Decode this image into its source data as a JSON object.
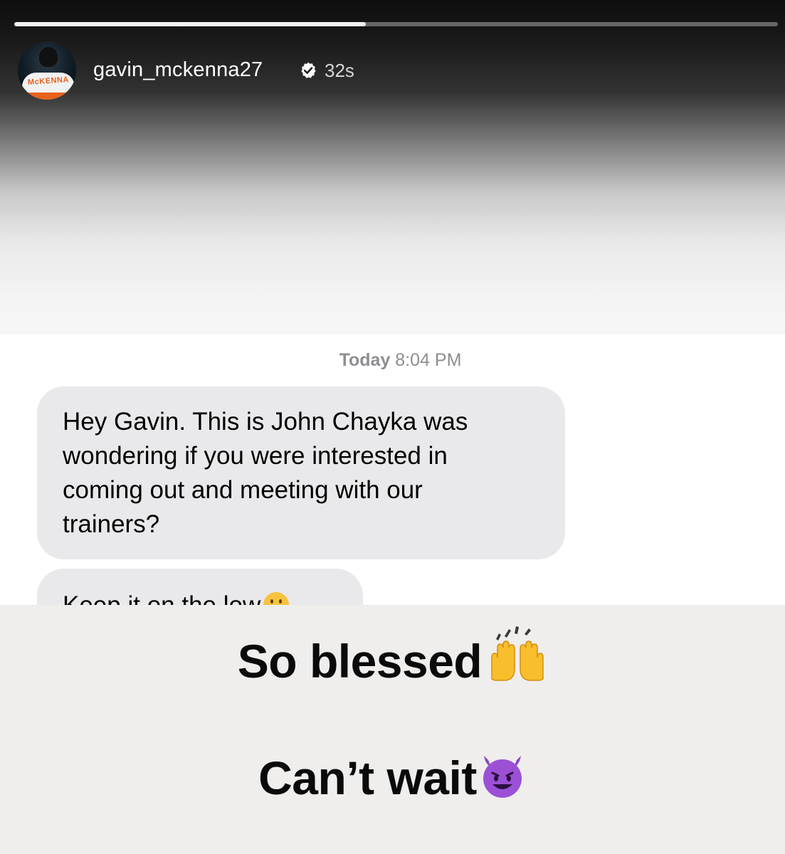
{
  "story": {
    "progress_fraction": 0.46,
    "user": {
      "username": "gavin_mckenna27",
      "verified": true,
      "posted_ago": "32s",
      "avatar_jersey_text": "McKENNA"
    }
  },
  "message": {
    "timestamp_day": "Today",
    "timestamp_time": "8:04 PM",
    "bubbles": [
      {
        "lines": [
          "Hey Gavin. This is John Chayka was",
          "wondering if you were interested in",
          "coming out and meeting with our",
          "trainers?"
        ]
      },
      {
        "lines": [
          "Keep it on the low"
        ],
        "emoji": "shushing-face-icon"
      }
    ]
  },
  "captions": [
    {
      "text": "So blessed",
      "emoji": "raising-hands-icon"
    },
    {
      "text": "Can’t wait",
      "emoji": "smiling-devil-icon"
    }
  ],
  "colors": {
    "bubble_bg": "#e9e9eb",
    "caption_bg": "#efeeec",
    "timestamp_gray": "#8e8e93"
  }
}
